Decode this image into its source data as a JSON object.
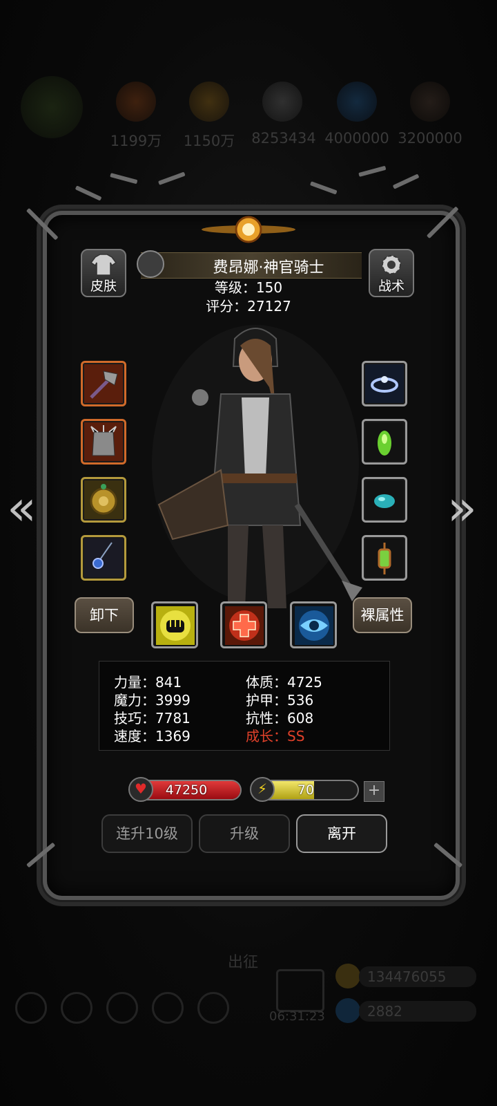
{
  "background": {
    "resources": [
      {
        "icon": "orange-orb-icon",
        "value": "1199万"
      },
      {
        "icon": "gold-orb-icon",
        "value": "1150万"
      },
      {
        "icon": "stone-orb-icon",
        "value": "8253434"
      },
      {
        "icon": "blue-orb-icon",
        "value": "4000000"
      },
      {
        "icon": "dark-orb-icon",
        "value": "3200000"
      }
    ],
    "bottom_label": "出征",
    "timer": "06:31:23",
    "gold_count": "134476055",
    "gem_count": "2882"
  },
  "hero": {
    "name": "费昂娜·神官骑士",
    "level_label": "等级：150",
    "score_label": "评分：27127"
  },
  "header_buttons": {
    "skin": "皮肤",
    "tactics": "战术"
  },
  "equipment": {
    "left": [
      {
        "name": "war-hammer-icon",
        "frame": "orange"
      },
      {
        "name": "spiked-armor-icon",
        "frame": "orange"
      },
      {
        "name": "golden-medallion-icon",
        "frame": "gold"
      },
      {
        "name": "sapphire-amulet-icon",
        "frame": "gold"
      }
    ],
    "right": [
      {
        "name": "crystal-ring-icon",
        "frame": "grey"
      },
      {
        "name": "green-potion-icon",
        "frame": "grey"
      },
      {
        "name": "turquoise-stone-icon",
        "frame": "grey"
      },
      {
        "name": "green-lantern-icon",
        "frame": "grey"
      }
    ]
  },
  "actions": {
    "unequip": "卸下",
    "base_stats": "裸属性"
  },
  "skills": [
    {
      "name": "fist-skill-icon"
    },
    {
      "name": "heal-cross-skill-icon"
    },
    {
      "name": "eye-skill-icon"
    }
  ],
  "stats": {
    "strength": "力量：841",
    "constitution": "体质：4725",
    "magic": "魔力：3999",
    "armor": "护甲：536",
    "skill": "技巧：7781",
    "resistance": "抗性：608",
    "speed": "速度：1369",
    "growth": "成长：SS"
  },
  "bars": {
    "hp": "47250",
    "energy": "70",
    "energy_fraction": 0.58
  },
  "buttons": {
    "level_up_10": "连升10级",
    "level_up": "升级",
    "leave": "离开"
  },
  "colors": {
    "hp_red": "#c4151c",
    "energy_yellow": "#e2d43a",
    "growth_red": "#e0412a"
  }
}
